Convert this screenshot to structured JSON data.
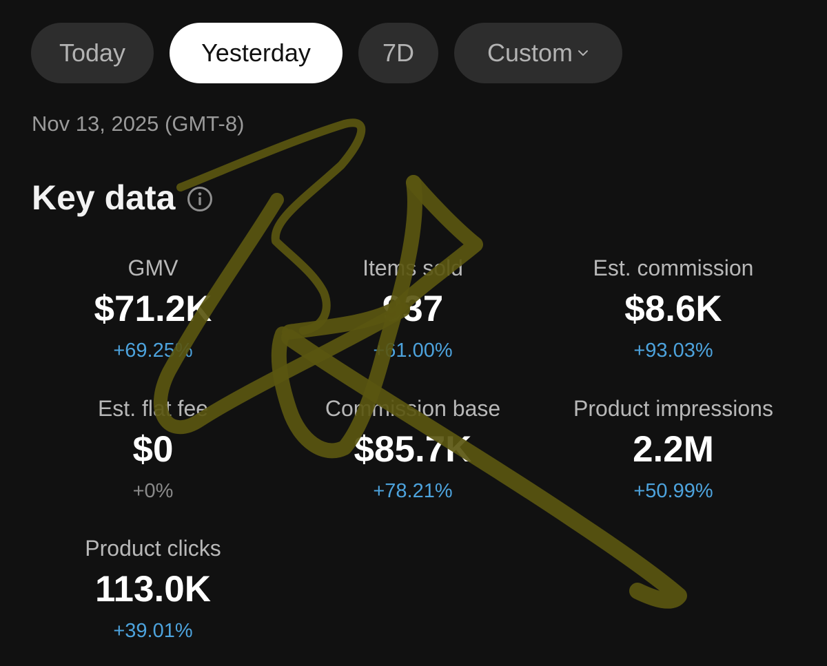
{
  "tabs": [
    {
      "label": "Today",
      "active": false
    },
    {
      "label": "Yesterday",
      "active": true
    },
    {
      "label": "7D",
      "active": false
    },
    {
      "label": "Custom",
      "active": false
    }
  ],
  "date": "Nov 13, 2025 (GMT-8)",
  "section_title": "Key data",
  "metrics": {
    "gmv": {
      "label": "GMV",
      "value": "$71.2K",
      "change": "+69.25%"
    },
    "items_sold": {
      "label": "Items sold",
      "value": "937",
      "change": "+61.00%"
    },
    "est_commission": {
      "label": "Est. commission",
      "value": "$8.6K",
      "change": "+93.03%"
    },
    "est_flat_fee": {
      "label": "Est. flat fee",
      "value": "$0",
      "change": "+0%"
    },
    "commission_base": {
      "label": "Commission base",
      "value": "$85.7K",
      "change": "+78.21%"
    },
    "product_impressions": {
      "label": "Product impressions",
      "value": "2.2M",
      "change": "+50.99%"
    },
    "product_clicks": {
      "label": "Product clicks",
      "value": "113.0K",
      "change": "+39.01%"
    }
  },
  "colors": {
    "background": "#111111",
    "tab_inactive": "#2d2d2d",
    "tab_active": "#ffffff",
    "positive_change": "#4da3dd",
    "neutral_change": "#8a8a8a",
    "scribble": "#5a5610"
  },
  "icons": {
    "info": "info-icon",
    "dropdown": "chevron-down-icon"
  }
}
